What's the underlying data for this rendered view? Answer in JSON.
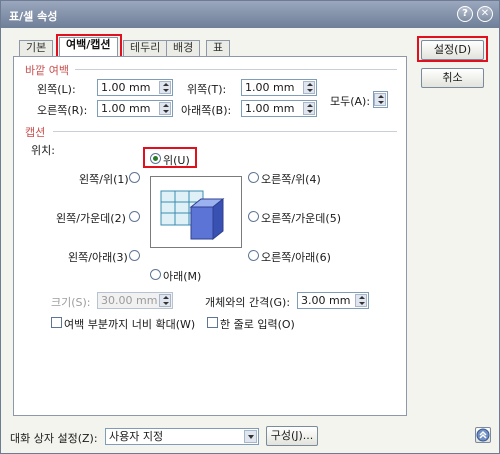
{
  "window": {
    "title": "표/셀 속성",
    "help_glyph": "?",
    "close_glyph": "✕"
  },
  "tabs": [
    {
      "label": "기본"
    },
    {
      "label": "여백/캡션"
    },
    {
      "label": "테두리"
    },
    {
      "label": "배경"
    },
    {
      "label": "표"
    }
  ],
  "outer_margin": {
    "title": "바깥 여백",
    "left_label": "왼쪽(L):",
    "left_value": "1.00 mm",
    "right_label": "오른쪽(R):",
    "right_value": "1.00 mm",
    "top_label": "위쪽(T):",
    "top_value": "1.00 mm",
    "bottom_label": "아래쪽(B):",
    "bottom_value": "1.00 mm",
    "all_label": "모두(A):"
  },
  "caption": {
    "title": "캡션",
    "position_label": "위치:",
    "options": {
      "top": "위(U)",
      "left_top": "왼쪽/위(1)",
      "right_top": "오른쪽/위(4)",
      "left_center": "왼쪽/가운데(2)",
      "right_center": "오른쪽/가운데(5)",
      "left_bottom": "왼쪽/아래(3)",
      "right_bottom": "오른쪽/아래(6)",
      "bottom": "아래(M)"
    },
    "selected": "top",
    "size_label": "크기(S):",
    "size_value": "30.00 mm",
    "gap_label": "개체와의 간격(G):",
    "gap_value": "3.00 mm",
    "extend_label": "여백 부분까지 너비 확대(W)",
    "single_line_label": "한 줄로 입력(O)"
  },
  "buttons": {
    "ok": "설정(D)",
    "cancel": "취소",
    "config": "구성(J)..."
  },
  "footer": {
    "preset_label": "대화 상자 설정(Z):",
    "preset_value": "사용자 지정"
  },
  "colors": {
    "highlight": "#e0101e",
    "section_title": "#c6504f",
    "title_bar": "#7f8ea6"
  }
}
